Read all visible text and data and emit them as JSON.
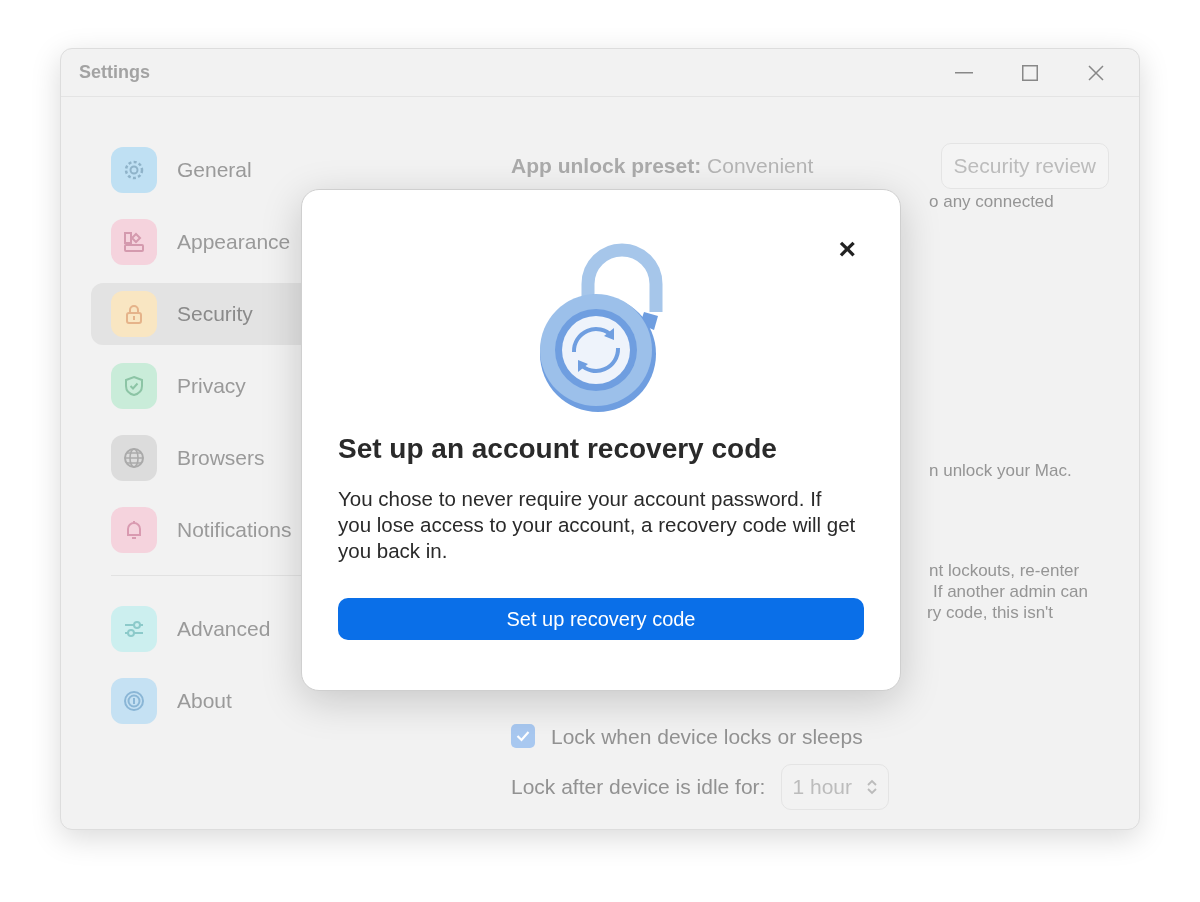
{
  "window": {
    "title": "Settings"
  },
  "sidebar": {
    "items": [
      {
        "label": "General",
        "color": "#bfe0f3",
        "selected": false
      },
      {
        "label": "Appearance",
        "color": "#f5d3dd",
        "selected": false
      },
      {
        "label": "Security",
        "color": "#f9e6c2",
        "selected": true
      },
      {
        "label": "Privacy",
        "color": "#c9ecd9",
        "selected": false
      },
      {
        "label": "Browsers",
        "color": "#dcdcdc",
        "selected": false
      },
      {
        "label": "Notifications",
        "color": "#f5d3dd",
        "selected": false
      }
    ],
    "footer_items": [
      {
        "label": "Advanced",
        "color": "#ccefef",
        "selected": false
      },
      {
        "label": "About",
        "color": "#c5e1f3",
        "selected": false
      }
    ]
  },
  "content": {
    "preset": "**App unlock preset:** Convenient",
    "review_button": "Security review",
    "fragments": [
      "o any connected",
      "n unlock your Mac."
    ],
    "fragment_block": [
      "nt lockouts, re-enter",
      "If another admin can",
      "ry code, this isn't"
    ],
    "checkbox": {
      "label": "Lock when device locks or sleeps",
      "checked": true
    },
    "idle": {
      "label": "Lock after device is idle for:",
      "value": "1 hour"
    }
  },
  "dialog": {
    "title": "Set up an account recovery code",
    "body": "You chose to never require your account password. If you lose access to your account, a recovery code will get you back in.",
    "button": "Set up recovery code",
    "close": "×"
  }
}
